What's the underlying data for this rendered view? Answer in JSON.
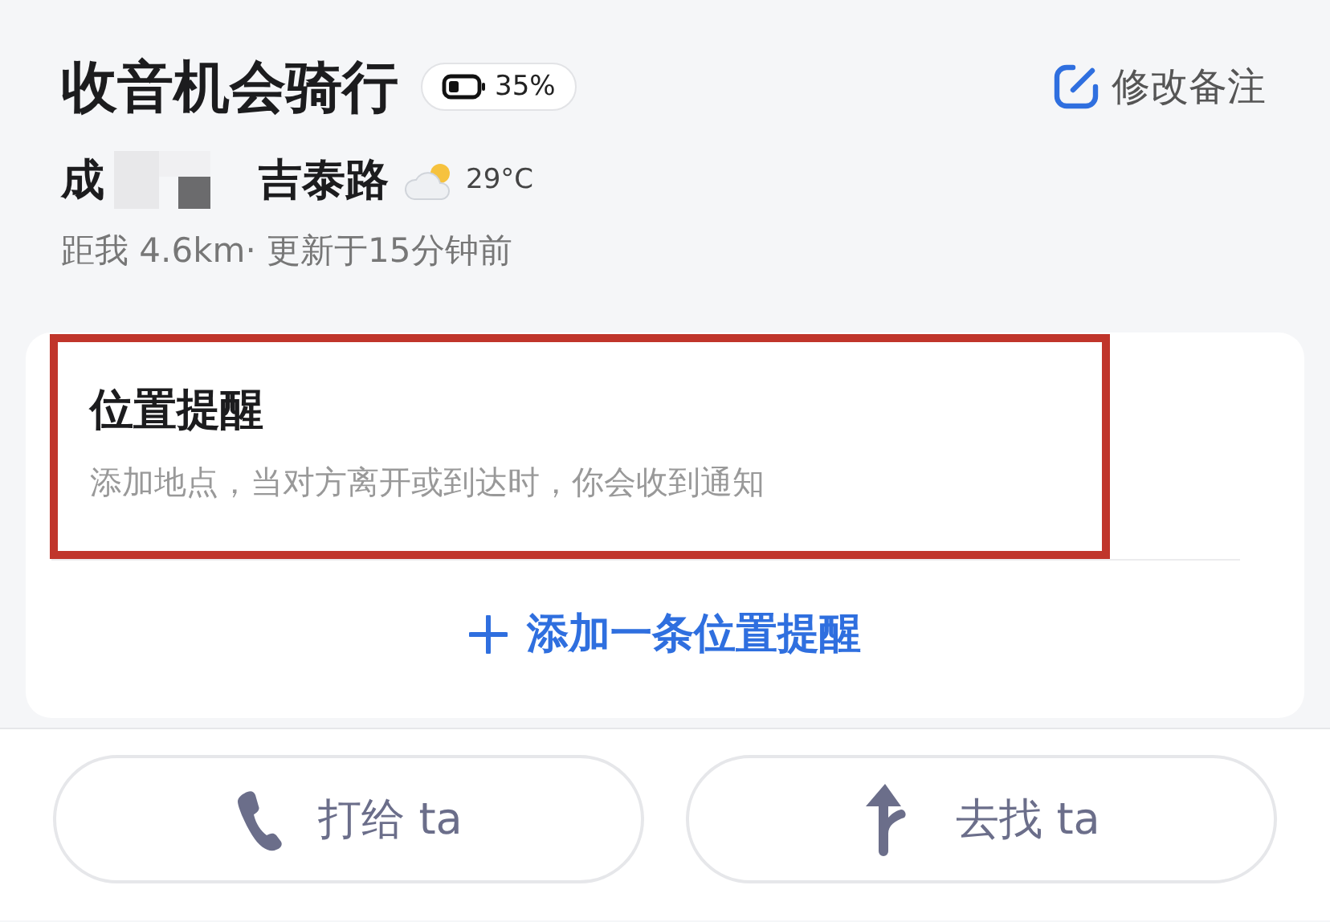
{
  "header": {
    "title": "收音机会骑行",
    "battery": "35%",
    "edit_link": "修改备注"
  },
  "location": {
    "address_start": "成",
    "address_end": "吉泰路",
    "temperature": "29°C",
    "status": "距我 4.6km· 更新于15分钟前"
  },
  "reminder_card": {
    "title": "位置提醒",
    "description": "添加地点，当对方离开或到达时，你会收到通知",
    "highlighted": true,
    "add_button": "添加一条位置提醒"
  },
  "actions": [
    {
      "kind": "call",
      "label": "打给 ta"
    },
    {
      "kind": "navigate",
      "label": "去找 ta"
    }
  ]
}
